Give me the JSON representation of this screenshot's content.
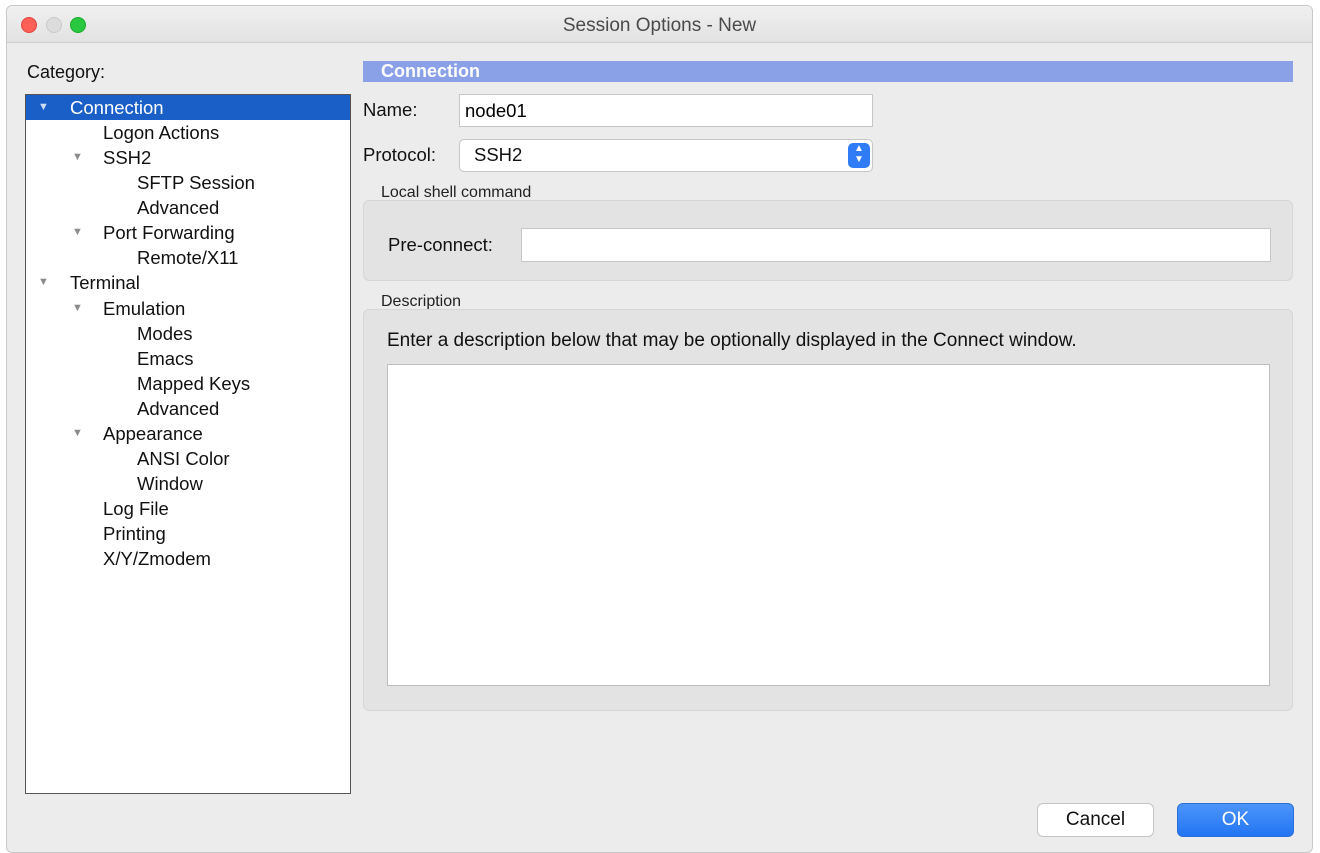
{
  "window": {
    "title": "Session Options - New"
  },
  "sidebar": {
    "category_label": "Category:",
    "items": [
      {
        "label": "Connection",
        "expanded": true,
        "selected": true
      },
      {
        "label": "Logon Actions"
      },
      {
        "label": "SSH2",
        "expanded": true
      },
      {
        "label": "SFTP Session"
      },
      {
        "label": "Advanced"
      },
      {
        "label": "Port Forwarding",
        "expanded": true
      },
      {
        "label": "Remote/X11"
      },
      {
        "label": "Terminal",
        "expanded": true
      },
      {
        "label": "Emulation",
        "expanded": true
      },
      {
        "label": "Modes"
      },
      {
        "label": "Emacs"
      },
      {
        "label": "Mapped Keys"
      },
      {
        "label": "Advanced"
      },
      {
        "label": "Appearance",
        "expanded": true
      },
      {
        "label": "ANSI Color"
      },
      {
        "label": "Window"
      },
      {
        "label": "Log File"
      },
      {
        "label": "Printing"
      },
      {
        "label": "X/Y/Zmodem"
      }
    ]
  },
  "panel": {
    "header": "Connection",
    "name_label": "Name:",
    "name_value": "node01",
    "protocol_label": "Protocol:",
    "protocol_value": "SSH2",
    "local_shell_group": "Local shell command",
    "preconnect_label": "Pre-connect:",
    "preconnect_value": "",
    "description_group": "Description",
    "description_hint": "Enter a description below that may be optionally displayed in the Connect window.",
    "description_value": ""
  },
  "buttons": {
    "cancel": "Cancel",
    "ok": "OK"
  },
  "colors": {
    "selection": "#1a5fc8",
    "header": "#8aa1e8",
    "ok_button": "#2274f3"
  }
}
